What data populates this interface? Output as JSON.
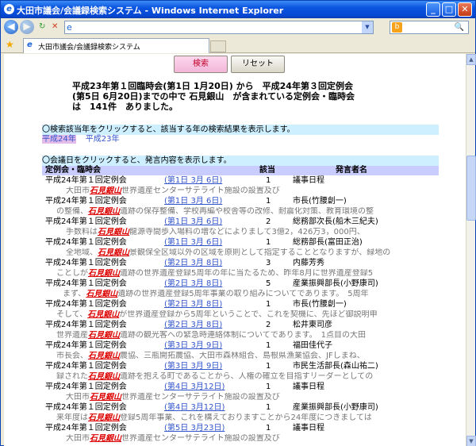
{
  "window": {
    "title": "大田市議会/会議録検索システム - Windows Internet Explorer",
    "min": "_",
    "max": "□",
    "close": "✕"
  },
  "nav": {
    "back": "◀",
    "forward": "▶",
    "refresh": "↻",
    "stop": "✕",
    "page_icon": "e",
    "dropdown": "▼",
    "search_btn": "🔍",
    "search_icon": "b"
  },
  "tabs": {
    "star": "★",
    "active_label": "大田市議会/会議録検索システム",
    "tab_icon": "e"
  },
  "buttons": {
    "search": "検索",
    "reset": "リセット"
  },
  "summary": [
    "平成23年第１回臨時会(第1日 1月20日) から　平成24年第３回定例会",
    "(第5日 6月20日)までの中で 石見銀山　が含まれている定例会・臨時会",
    "は　141件　ありました。"
  ],
  "info1": "〇検索該当年をクリックすると、該当する年の検索結果を表示します。",
  "years": [
    "平成24年",
    "平成23年"
  ],
  "info2": "〇会議日をクリックすると、発言内容を表示します。",
  "headers": {
    "session": "定例会・臨時会",
    "hits": "該当",
    "speaker": "発言者名"
  },
  "hl_term": "石見銀山",
  "results": [
    {
      "session": "平成24年第１回定例会",
      "date": "(第1日 3月 6日)",
      "hits": "1",
      "speaker": "議事日程",
      "pre": "大田市",
      "post": "世界遺産センターサテライト施設の設置及び",
      "indent": 30
    },
    {
      "session": "平成24年第１回定例会",
      "date": "(第1日 3月 6日)",
      "hits": "1",
      "speaker": "市長(竹腰創一)",
      "pre": "の整備、",
      "post": "遺跡の保存整備、学校再編や校舎等の改修、耐震化対策、教育環境の整",
      "indent": 18
    },
    {
      "session": "平成24年第１回定例会",
      "date": "(第1日 3月 6日)",
      "hits": "2",
      "speaker": "総務部次長(船木三紀夫)",
      "pre": "手数料は",
      "post": "龍源寺間歩入場料の増などによりまして3億2，426万3，000円、",
      "indent": 30
    },
    {
      "session": "平成24年第１回定例会",
      "date": "(第1日 3月 6日)",
      "hits": "1",
      "speaker": "総務部長(富田正治)",
      "pre": "全地域、",
      "post": "景観保全区域以外の区域を原則として指定することとなりますが、緑地の",
      "indent": 30
    },
    {
      "session": "平成24年第１回定例会",
      "date": "(第2日 3月 8日)",
      "hits": "3",
      "speaker": "内藤芳秀",
      "pre": "ことしが",
      "post": "遺跡の世界遺産登録5周年の年に当たるため、昨年8月に世界遺産登録5",
      "indent": 18
    },
    {
      "session": "平成24年第１回定例会",
      "date": "(第2日 3月 8日)",
      "hits": "5",
      "speaker": "産業振興部長(小野康司)",
      "pre": "まず、",
      "post": "遺跡の世界遺産登録5周年事業の取り組みについてであります。　5周年",
      "indent": 26
    },
    {
      "session": "平成24年第１回定例会",
      "date": "(第2日 3月 8日)",
      "hits": "1",
      "speaker": "市長(竹腰創一)",
      "pre": "そして、",
      "post": "が世界遺産登録から5周年ということで、これを契機に、先ほど御説明申",
      "indent": 18
    },
    {
      "session": "平成24年第１回定例会",
      "date": "(第2日 3月 8日)",
      "hits": "2",
      "speaker": "松井東司彦",
      "pre": "世界遺産",
      "post": "遺跡の観光客への緊急時連絡体制についてであります。　1点目の大田",
      "indent": 18
    },
    {
      "session": "平成24年第１回定例会",
      "date": "(第3日 3月 9日)",
      "hits": "1",
      "speaker": "福田佳代子",
      "pre": "市長会、",
      "post": "農協、三瓶開拓農協、大田市森林組合、島根県漁業協会、JFしまね、",
      "indent": 18
    },
    {
      "session": "平成24年第１回定例会",
      "date": "(第3日 3月 9日)",
      "hits": "1",
      "speaker": "市民生活部長(森山祐二)",
      "pre": "録された",
      "post": "遺跡を抱える町であることから、人権の確立を目指すリーダーとしての",
      "indent": 18
    },
    {
      "session": "平成24年第１回定例会",
      "date": "(第4日 3月12日)",
      "hits": "1",
      "speaker": "議事日程",
      "pre": "大田市",
      "post": "世界遺産センターサテライト施設の設置及び",
      "indent": 30
    },
    {
      "session": "平成24年第１回定例会",
      "date": "(第4日 3月12日)",
      "hits": "1",
      "speaker": "産業振興部長(小野康司)",
      "pre": "来年度は",
      "post": "登録5周年事業、これを構えておりますことから24年度につきましては",
      "indent": 18
    },
    {
      "session": "平成24年第１回定例会",
      "date": "(第5日 3月23日)",
      "hits": "1",
      "speaker": "議事日程",
      "pre": "大田市",
      "post": "世界遺産センターサテライト施設の設置及び",
      "indent": 30
    }
  ]
}
